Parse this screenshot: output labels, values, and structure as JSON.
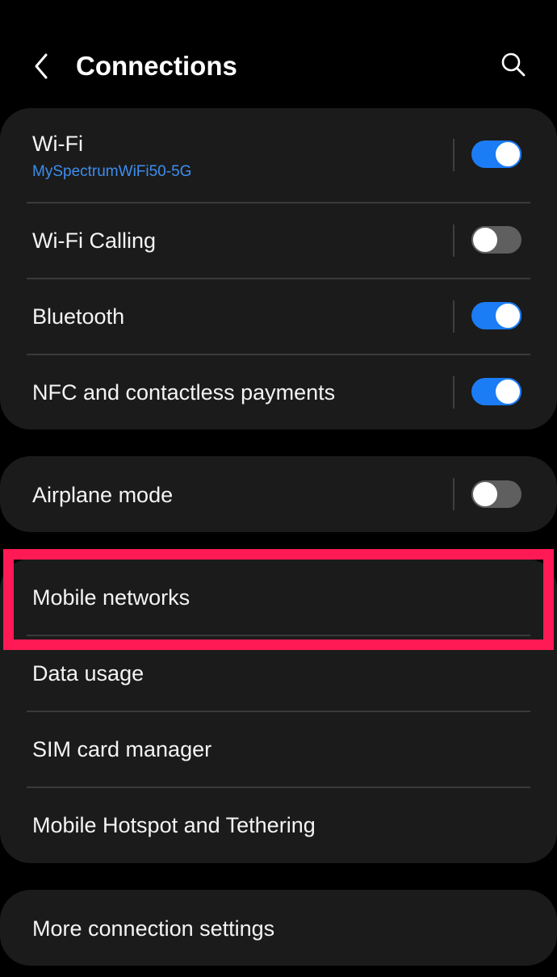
{
  "header": {
    "back_icon": "chevron-left-icon",
    "title": "Connections",
    "search_icon": "search-icon"
  },
  "colors": {
    "background": "#000000",
    "card": "#1b1b1b",
    "accent": "#1b7cf5",
    "toggle_off": "#5f5f5f",
    "highlight": "#ff1a55",
    "subtitle": "#3d8ef0"
  },
  "groups": [
    {
      "items": [
        {
          "label": "Wi-Fi",
          "subtitle": "MySpectrumWiFi50-5G",
          "toggle": true
        },
        {
          "label": "Wi-Fi Calling",
          "toggle": false
        },
        {
          "label": "Bluetooth",
          "toggle": true
        },
        {
          "label": "NFC and contactless payments",
          "toggle": true
        }
      ]
    },
    {
      "items": [
        {
          "label": "Airplane mode",
          "toggle": false
        }
      ]
    },
    {
      "items": [
        {
          "label": "Mobile networks",
          "highlighted": true
        },
        {
          "label": "Data usage"
        },
        {
          "label": "SIM card manager"
        },
        {
          "label": "Mobile Hotspot and Tethering"
        }
      ]
    },
    {
      "items": [
        {
          "label": "More connection settings"
        }
      ]
    }
  ]
}
